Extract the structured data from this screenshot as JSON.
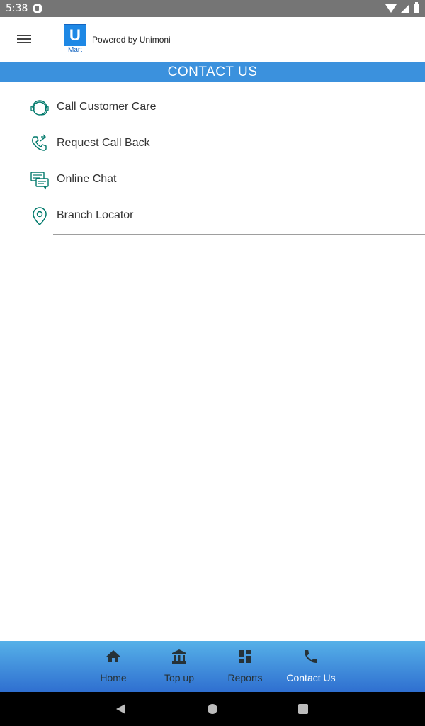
{
  "status_bar": {
    "time": "5:38"
  },
  "header": {
    "powered_by": "Powered by Unimoni",
    "logo_letter": "U",
    "logo_sub": "Mart"
  },
  "page": {
    "title": "CONTACT US"
  },
  "contact_items": [
    {
      "label": "Call Customer Care",
      "icon": "headset-icon"
    },
    {
      "label": "Request Call Back",
      "icon": "phone-callback-icon"
    },
    {
      "label": "Online Chat",
      "icon": "chat-icon"
    },
    {
      "label": "Branch Locator",
      "icon": "location-pin-icon"
    }
  ],
  "bottom_nav": [
    {
      "label": "Home",
      "icon": "home-icon"
    },
    {
      "label": "Top up",
      "icon": "bank-icon"
    },
    {
      "label": "Reports",
      "icon": "dashboard-icon"
    },
    {
      "label": "Contact Us",
      "icon": "phone-icon",
      "active": true
    }
  ],
  "colors": {
    "title_bar": "#3b91dd",
    "icon_teal": "#00796b",
    "nav_gradient_top": "#56b1e8",
    "nav_gradient_bottom": "#2f6fd0"
  }
}
